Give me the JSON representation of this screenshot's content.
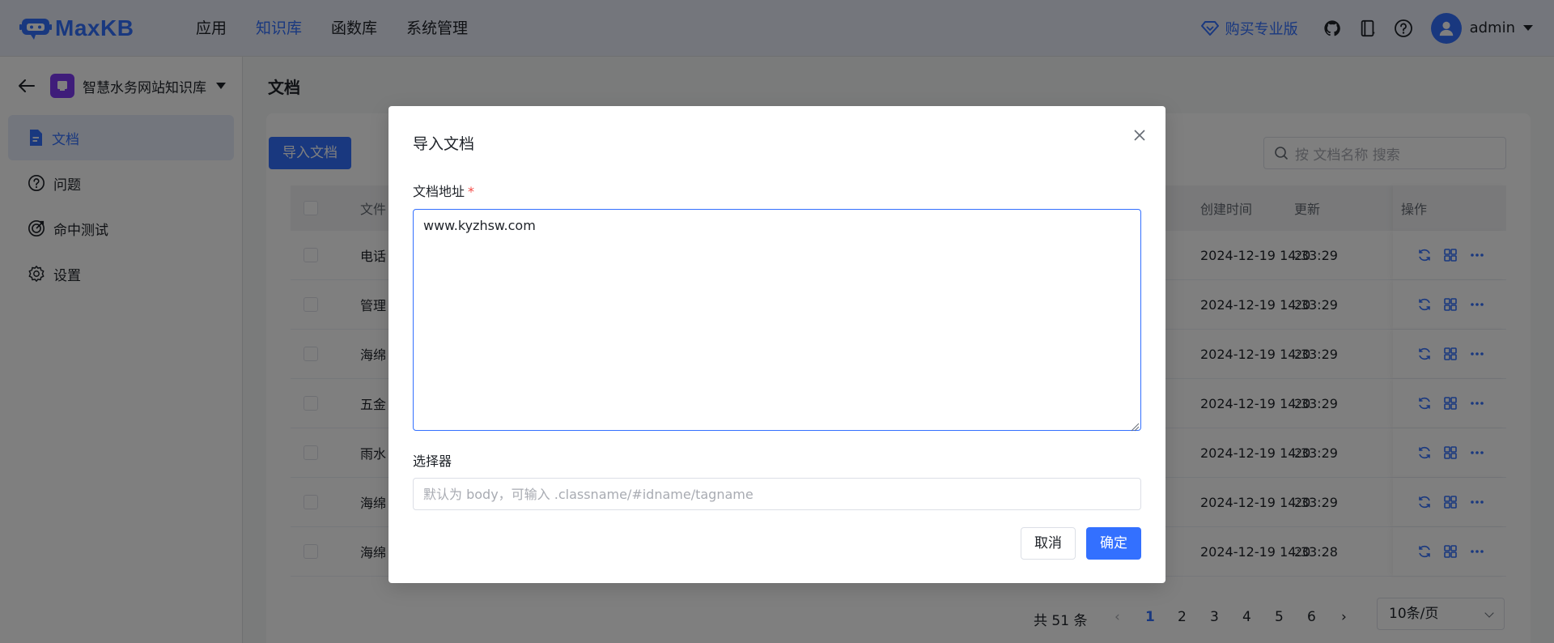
{
  "header": {
    "logo_text": "MaxKB",
    "nav": [
      "应用",
      "知识库",
      "函数库",
      "系统管理"
    ],
    "active_nav": "知识库",
    "buy_pro": "购买专业版",
    "username": "admin"
  },
  "sidebar": {
    "kb_name": "智慧水务网站知识库",
    "items": [
      {
        "label": "文档",
        "icon": "document-icon"
      },
      {
        "label": "问题",
        "icon": "question-icon"
      },
      {
        "label": "命中测试",
        "icon": "target-icon"
      },
      {
        "label": "设置",
        "icon": "gear-icon"
      }
    ]
  },
  "main": {
    "title": "文档",
    "import_button": "导入文档",
    "search_placeholder": "按 文档名称 搜索",
    "columns": {
      "name": "文件",
      "created": "创建时间",
      "updated": "更新",
      "ops": "操作"
    },
    "rows": [
      {
        "name": "电话",
        "created": "2024-12-19 14:33:29",
        "updated": "20"
      },
      {
        "name": "管理",
        "created": "2024-12-19 14:33:29",
        "updated": "20"
      },
      {
        "name": "海绵",
        "created": "2024-12-19 14:33:29",
        "updated": "20"
      },
      {
        "name": "五金",
        "created": "2024-12-19 14:33:29",
        "updated": "20"
      },
      {
        "name": "雨水",
        "created": "2024-12-19 14:33:29",
        "updated": "20"
      },
      {
        "name": "海绵",
        "created": "2024-12-19 14:33:29",
        "updated": "20"
      },
      {
        "name": "海绵",
        "created": "2024-12-19 14:33:28",
        "updated": "20"
      }
    ],
    "pagination": {
      "total": "共 51 条",
      "pages": [
        "1",
        "2",
        "3",
        "4",
        "5",
        "6"
      ],
      "current": "1",
      "page_size": "10条/页"
    }
  },
  "dialog": {
    "title": "导入文档",
    "url_label": "文档地址",
    "required_mark": "*",
    "url_value": "www.kyzhsw.com",
    "selector_label": "选择器",
    "selector_placeholder": "默认为 body，可输入 .classname/#idname/tagname",
    "cancel": "取消",
    "confirm": "确定"
  },
  "colors": {
    "primary": "#3370ff",
    "kb_avatar": "#7f3bf5",
    "required": "#f54a45"
  }
}
